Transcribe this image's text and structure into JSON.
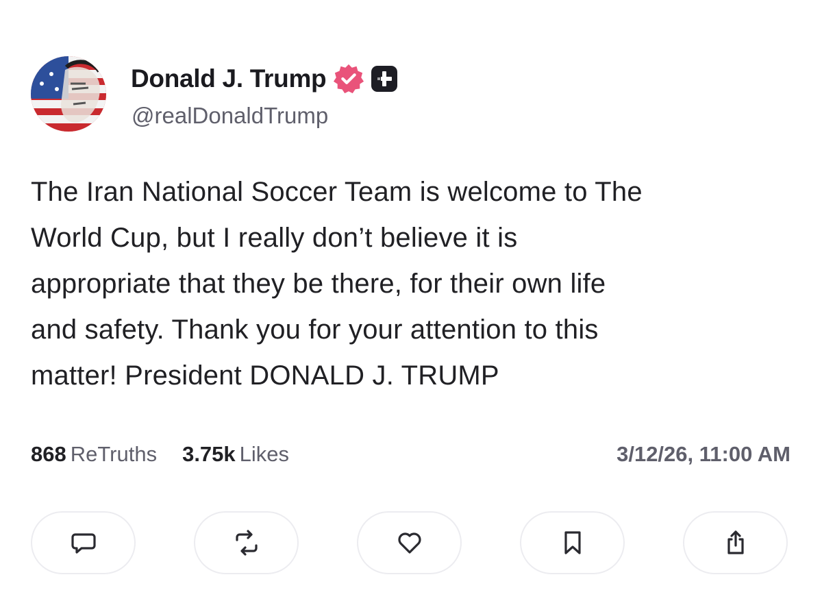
{
  "profile": {
    "display_name": "Donald J. Trump",
    "handle": "@realDonaldTrump",
    "avatar_icon": "avatar-image",
    "verified_icon": "verified-badge-icon",
    "plus_icon": "plus-badge-icon"
  },
  "post": {
    "text": "The Iran National Soccer Team is welcome to The\nWorld Cup, but I really don’t believe it is\nappropriate that they be there, for their own life\nand safety. Thank you for your attention to this\nmatter! President DONALD J. TRUMP"
  },
  "stats": {
    "retruths_count": "868",
    "retruths_label": "ReTruths",
    "likes_count": "3.75k",
    "likes_label": "Likes",
    "timestamp": "3/12/26, 11:00 AM"
  },
  "actions": [
    {
      "icon": "reply-icon"
    },
    {
      "icon": "retruth-icon"
    },
    {
      "icon": "like-heart-icon"
    },
    {
      "icon": "bookmark-icon"
    },
    {
      "icon": "share-icon"
    }
  ],
  "colors": {
    "verified_badge": "#e9537a",
    "text_primary": "#202024",
    "text_secondary": "#5f5f6b",
    "button_border": "#ececf0"
  }
}
